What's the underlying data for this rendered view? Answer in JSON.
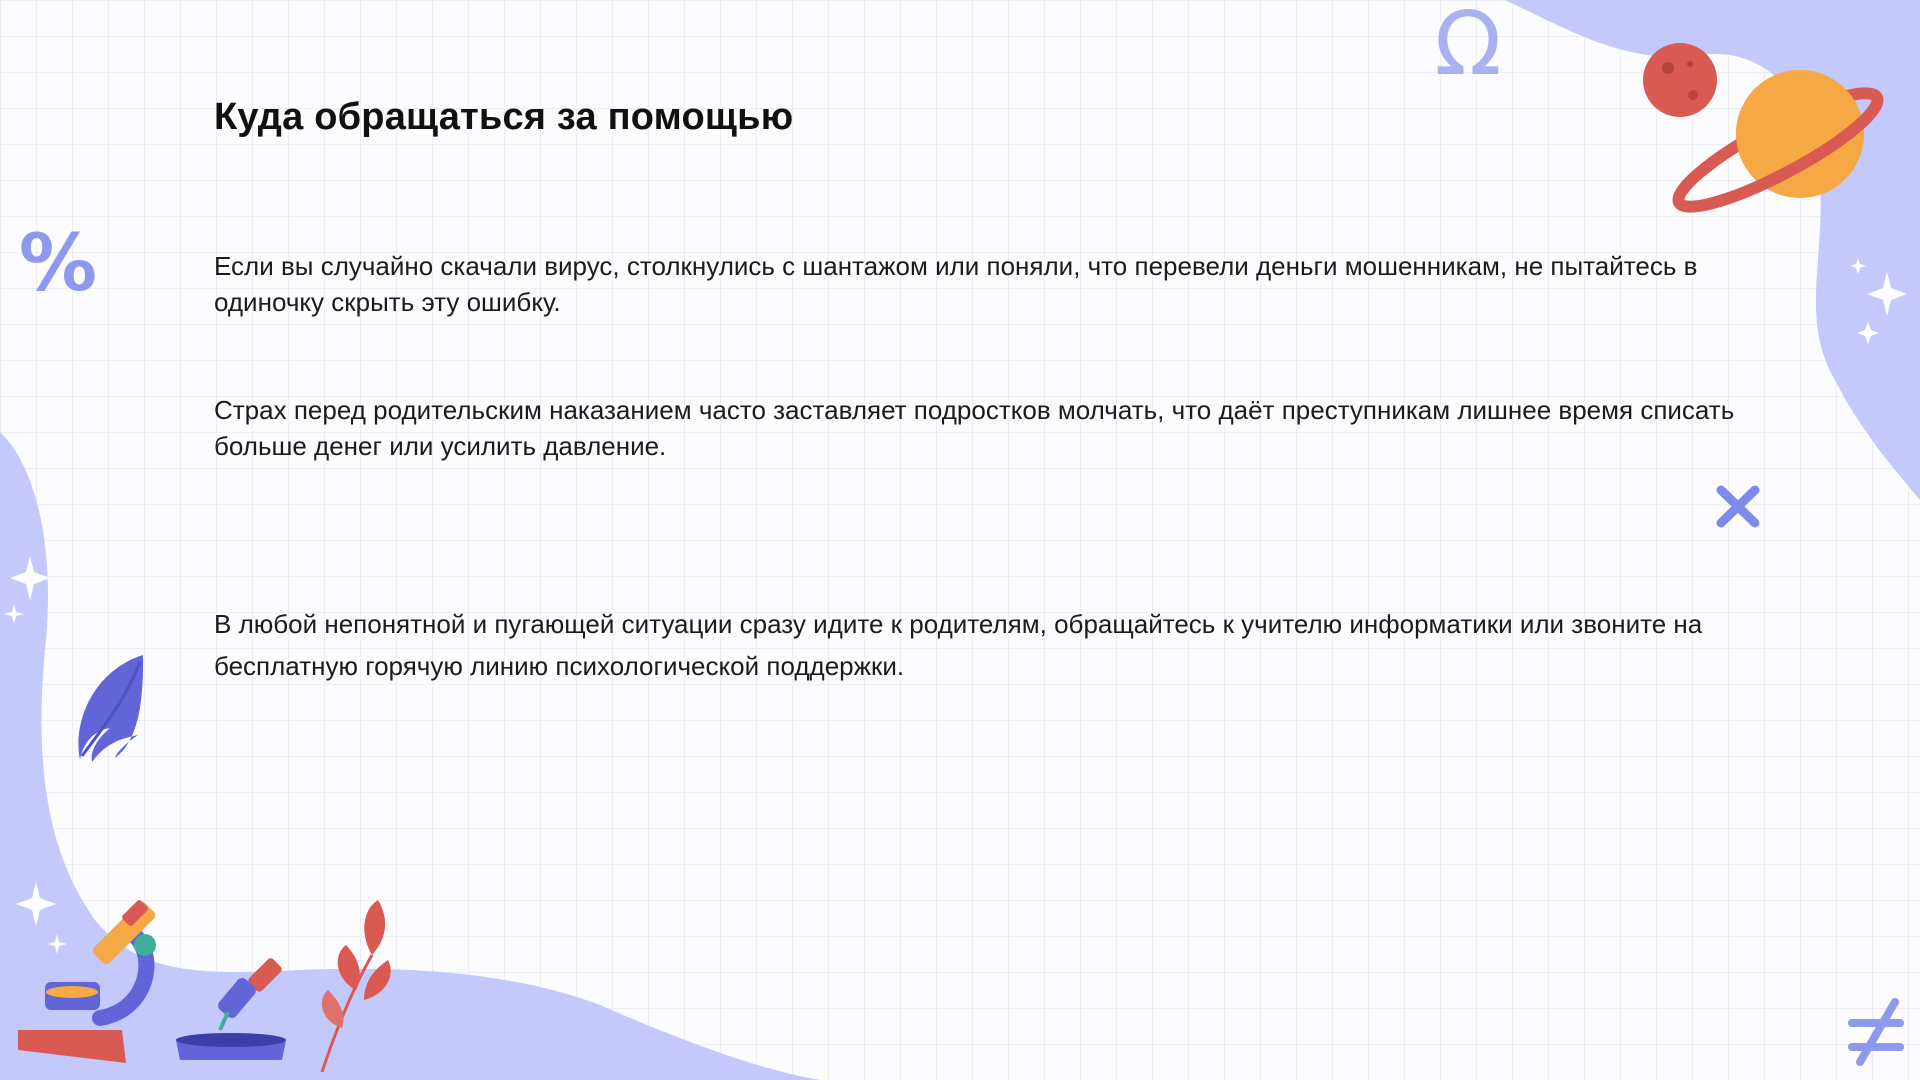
{
  "slide": {
    "title": "Куда обращаться за помощью",
    "paragraphs": [
      "Если вы случайно скачали вирус, столкнулись с шантажом или поняли, что перевели деньги мошенникам, не пытайтесь в одиночку скрыть эту ошибку.",
      "Страх перед родительским наказанием часто заставляет подростков молчать, что даёт преступникам лишнее время списать больше денег или усилить давление.",
      "В любой непонятной и пугающей ситуации сразу идите к родителям, обращайтесь к учителю информатики или звоните на бесплатную горячую линию психологической поддержки."
    ]
  },
  "decorations": {
    "math_symbols": [
      "Ω",
      "%",
      "×",
      "≠"
    ],
    "icons": [
      "planet-red-icon",
      "planet-saturn-icon",
      "sparkle-icon",
      "leaf-icon",
      "microscope-icon",
      "pipette-icon",
      "plant-icon"
    ]
  },
  "colors": {
    "blob": "#c3c9fa",
    "symbol": "#8e98ec",
    "accent_orange": "#f5a843",
    "accent_red": "#d95a52",
    "leaf_purple": "#6165d8"
  }
}
